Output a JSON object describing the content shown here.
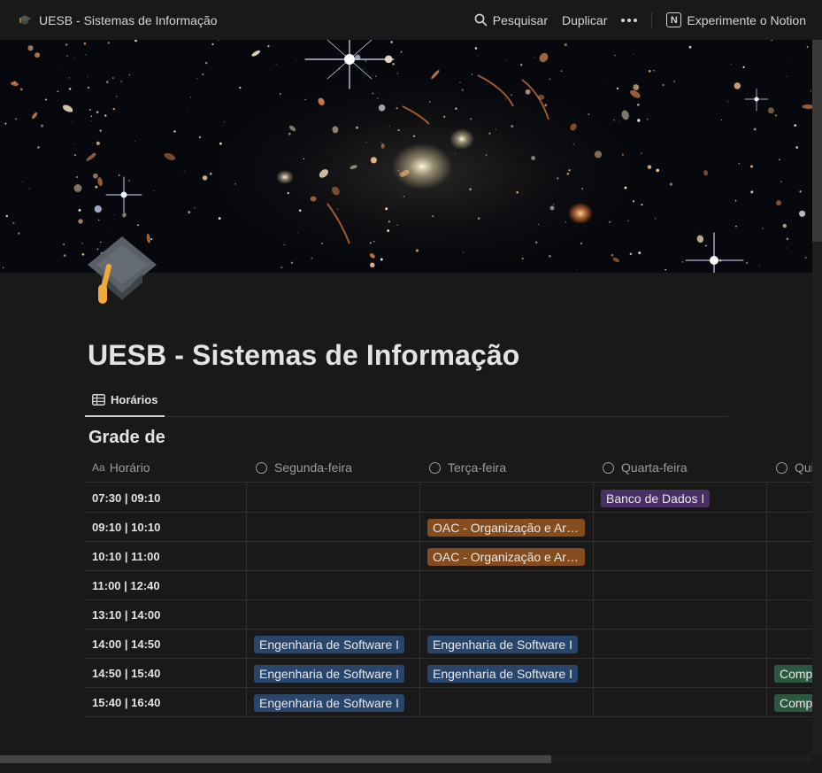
{
  "topbar": {
    "title": "UESB - Sistemas de Informação",
    "search_label": "Pesquisar",
    "duplicate_label": "Duplicar",
    "notion_label": "Experimente o Notion",
    "notion_logo": "N"
  },
  "page": {
    "title": "UESB - Sistemas de Informação",
    "icon": "graduation-cap-icon",
    "cover": "deep-field-space-image"
  },
  "view": {
    "tab_label": "Horários"
  },
  "database": {
    "title": "Grade de",
    "columns": [
      {
        "label": "Horário",
        "icon": "Aa"
      },
      {
        "label": "Segunda-feira"
      },
      {
        "label": "Terça-feira"
      },
      {
        "label": "Quarta-feira"
      },
      {
        "label": "Quinta-feira"
      }
    ],
    "rows": [
      {
        "time": "07:30 | 09:10",
        "cells": [
          "",
          "",
          "Banco de Dados I",
          ""
        ]
      },
      {
        "time": "09:10 | 10:10",
        "cells": [
          "",
          "OAC - Organização e Arquitetura de Computadores",
          "",
          ""
        ]
      },
      {
        "time": "10:10 | 11:00",
        "cells": [
          "",
          "OAC - Organização e Arquitetura de Computadores",
          "",
          ""
        ]
      },
      {
        "time": "11:00 | 12:40",
        "cells": [
          "",
          "",
          "",
          ""
        ]
      },
      {
        "time": "13:10 | 14:00",
        "cells": [
          "",
          "",
          "",
          ""
        ]
      },
      {
        "time": "14:00 | 14:50",
        "cells": [
          "Engenharia de Software I",
          "Engenharia de Software I",
          "",
          ""
        ]
      },
      {
        "time": "14:50 | 15:40",
        "cells": [
          "Engenharia de Software I",
          "Engenharia de Software I",
          "",
          "Comp"
        ]
      },
      {
        "time": "15:40 | 16:40",
        "cells": [
          "Engenharia de Software I",
          "",
          "",
          "Comp"
        ]
      }
    ]
  },
  "colors": {
    "background": "#191919",
    "tag_purple": "#492f64",
    "tag_brown": "#854c1d",
    "tag_blue": "#28456c",
    "tag_green": "#2b593f"
  }
}
